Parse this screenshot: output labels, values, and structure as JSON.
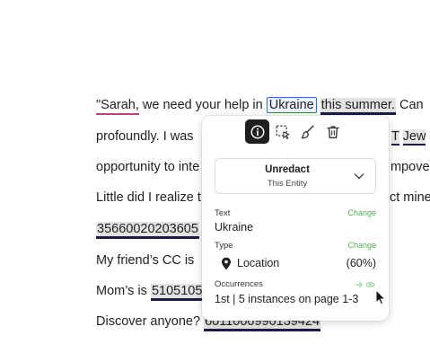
{
  "document": {
    "lines": [
      {
        "pre": "\"Sarah,",
        "mid": " we need your help in ",
        "entity": "Ukraine",
        "red": "this summer.",
        "post": " Can"
      },
      {
        "text": "profoundly. I was"
      },
      {
        "text": "opportunity to inte"
      },
      {
        "text": "Little did I realize t"
      },
      {
        "red": "35660020203605"
      },
      {
        "text": "My friend’s CC is"
      },
      {
        "pre": "Mom’s is ",
        "red": "5105105"
      },
      {
        "pre": "Discover anyone? ",
        "red": "6011000990139424"
      }
    ],
    "right_fragments": {
      "l2a": "T",
      "l2b": "Jew",
      "l3": "mpove",
      "l4": "ct mine"
    }
  },
  "popover": {
    "tools": [
      "info-icon",
      "select-area-icon",
      "brush-icon",
      "trash-icon"
    ],
    "dropdown": {
      "title": "Unredact",
      "subtitle": "This Entity"
    },
    "text_label": "Text",
    "text_change": "Change",
    "text_value": "Ukraine",
    "type_label": "Type",
    "type_change": "Change",
    "type_value": "Location",
    "type_confidence": "(60%)",
    "occ_label": "Occurrences",
    "occ_value": "1st | 5 instances on page 1-3"
  },
  "colors": {
    "accent_green": "#4caf50",
    "entity_blue": "#2f6fd6",
    "redaction_bar": "#1b1b4a"
  }
}
